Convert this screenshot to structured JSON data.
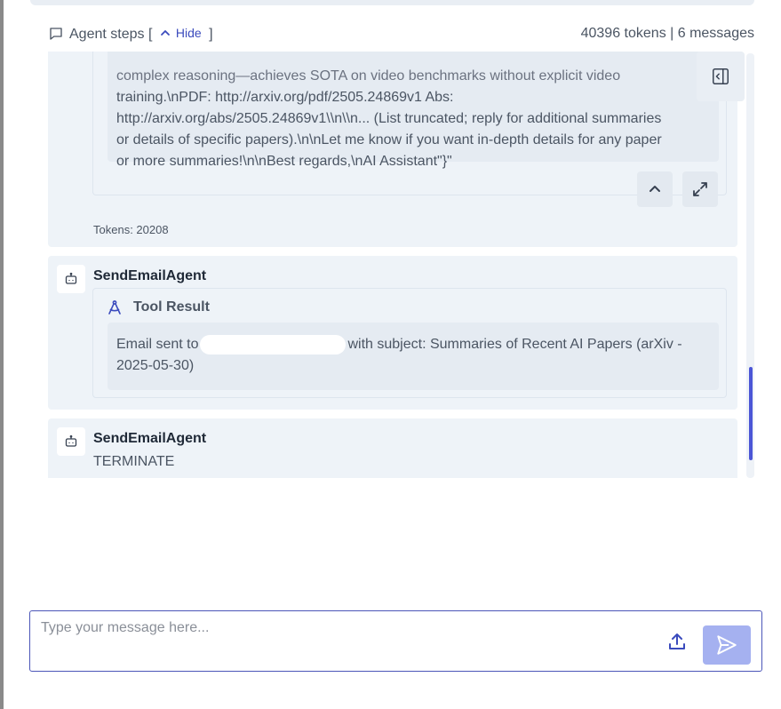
{
  "steps_header": {
    "title": "Agent steps",
    "bracket_open": "[",
    "hide_label": "Hide",
    "bracket_close": "]",
    "summary": "40396 tokens | 6 messages"
  },
  "messages": [
    {
      "content_lines": [
        "complex reasoning—achieves SOTA on video benchmarks without explicit video",
        "training.\\nPDF: http://arxiv.org/pdf/2505.24869v1 Abs:",
        "http://arxiv.org/abs/2505.24869v1\\\\n\\\\n... (List truncated; reply for additional summaries",
        "or details of specific papers).\\n\\nLet me know if you want in-depth details for any paper",
        "or more summaries!\\n\\nBest regards,\\nAI Assistant\"}\""
      ],
      "tokens_note": "Tokens: 20208"
    },
    {
      "agent": "SendEmailAgent",
      "tool_label": "Tool Result",
      "result_prefix": "Email sent to",
      "result_suffix": "with subject: Summaries of Recent AI Papers (arXiv -",
      "result_line2": "2025-05-30)"
    },
    {
      "agent": "SendEmailAgent",
      "content": "TERMINATE"
    }
  ],
  "composer": {
    "placeholder": "Type your message here..."
  },
  "icons": {
    "chat": "chat-bubble-icon",
    "hide": "chevron-up-icon",
    "side_panel": "sidebar-toggle-icon",
    "collapse": "chevron-up-icon",
    "expand": "maximize-icon",
    "agent": "robot-icon",
    "tool": "compass-icon",
    "upload": "upload-icon",
    "send": "send-icon"
  },
  "colors": {
    "accent": "#3b4bbd",
    "send_button": "#a5b1f0",
    "card_bg": "#eef3f8",
    "scroll_thumb": "#4b55d6"
  }
}
